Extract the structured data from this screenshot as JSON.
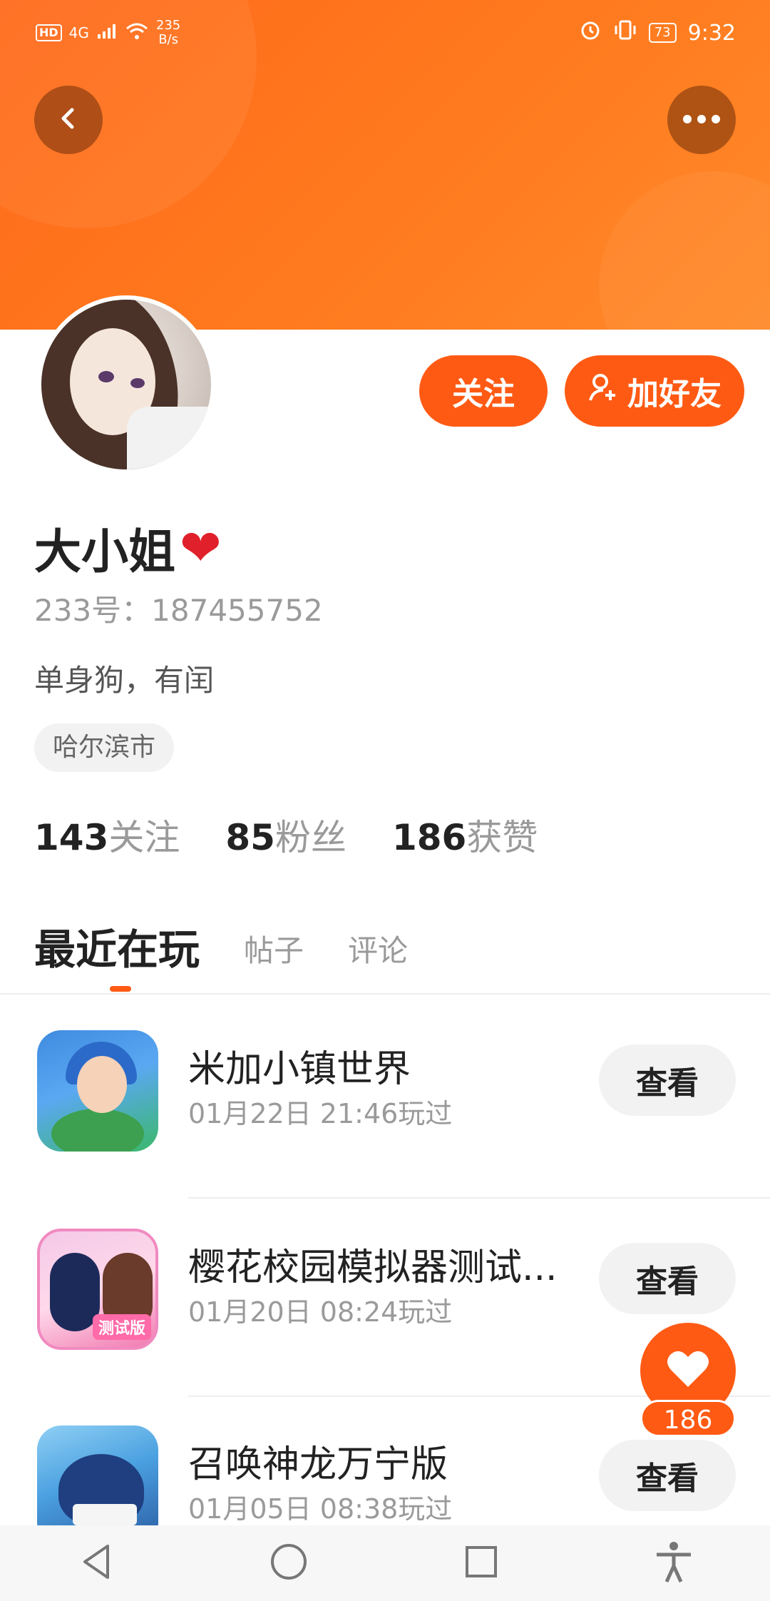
{
  "status_bar": {
    "network_hd": "HD",
    "network_type": "4G",
    "speed_value": "235",
    "speed_unit": "B/s",
    "battery": "73",
    "time": "9:32"
  },
  "header": {
    "back_icon": "chevron-left-icon",
    "more_icon": "more-horizontal-icon",
    "accent_color": "#ff5a14"
  },
  "profile": {
    "name": "大小姐",
    "name_emoji": "❤",
    "id_label": "233号：",
    "id_value": "187455752",
    "bio": "单身狗，有闰",
    "location": "哈尔滨市",
    "follow_button": "关注",
    "add_friend_button": "加好友"
  },
  "stats": [
    {
      "number": "143",
      "label": "关注"
    },
    {
      "number": "85",
      "label": "粉丝"
    },
    {
      "number": "186",
      "label": "获赞"
    }
  ],
  "tabs": {
    "active": "最近在玩",
    "posts": "帖子",
    "comments": "评论"
  },
  "games": [
    {
      "title": "米加小镇世界",
      "played": "01月22日 21:46玩过",
      "button": "查看"
    },
    {
      "title": "樱花校园模拟器测试...",
      "played": "01月20日 08:24玩过",
      "button": "查看",
      "badge": "测试版"
    },
    {
      "title": "召唤神龙万宁版",
      "played": "01月05日 08:38玩过",
      "button": "查看"
    }
  ],
  "like_fab": {
    "icon": "heart-icon",
    "count": "186"
  },
  "nav_bar": {
    "back": "triangle-back-icon",
    "home": "circle-home-icon",
    "recents": "square-recents-icon",
    "accessibility": "accessibility-icon"
  }
}
